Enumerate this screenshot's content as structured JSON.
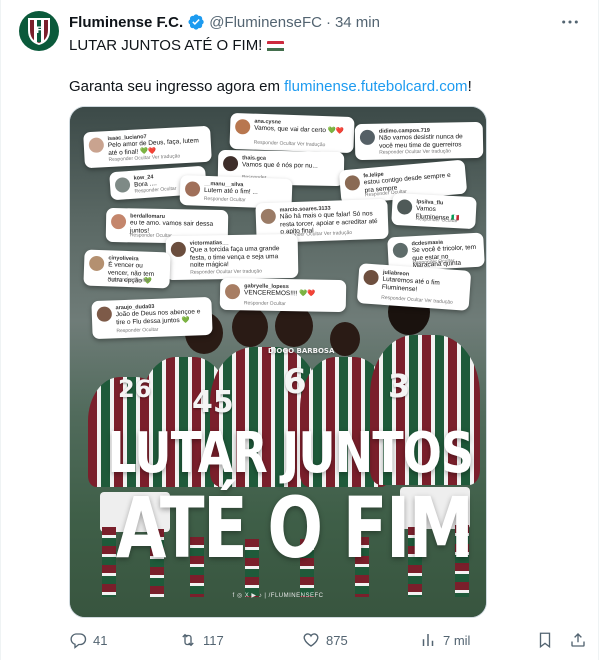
{
  "account": {
    "name": "Fluminense F.C.",
    "handle": "@FluminenseFC",
    "separator": "·",
    "time": "34 min"
  },
  "tweet": {
    "line1": "LUTAR JUNTOS ATÉ O FIM!",
    "line2_prefix": "Garanta seu ingresso agora em ",
    "link": "fluminense.futebolcard.com",
    "line2_suffix": "!"
  },
  "media": {
    "headline_1": "LUTAR JUNTOS",
    "headline_2": "ATÉ O FIM",
    "footer": "f ◎ X ▶ ♪ | /FLUMINENSEFC",
    "shirt_numbers": [
      "6",
      "45",
      "3",
      "26"
    ],
    "shirt_name": "DIOGO BARBOSA",
    "comments": [
      {
        "user": "isaac_luciano7",
        "text": "Pelo amor de Deus, faça, lutem até o final! 💚❤️",
        "actions": "Responder   Ocultar   Ver tradução"
      },
      {
        "user": "ana.cysne",
        "text": "Vamos, que vai dar certo 💚❤️",
        "actions": "Responder   Ocultar   Ver tradução"
      },
      {
        "user": "didimo.campos.719",
        "text": "Não vamos desistir nunca de você meu time de guerreiros",
        "actions": "Responder   Ocultar   Ver tradução"
      },
      {
        "user": "thais.gca",
        "text": "Vamos que é nós por nu...",
        "actions": "Responder"
      },
      {
        "user": "kow_24",
        "text": "Bora ....",
        "actions": "Responder   Ocultar"
      },
      {
        "user": "__manu__silva",
        "text": "Lutem até o fim! ...",
        "actions": "Responder   Ocultar"
      },
      {
        "user": "fe.lelipe",
        "text": "estou contigo desde sempre e pra sempre",
        "actions": "Responder   Ocultar"
      },
      {
        "user": "berdallomaru",
        "text": "eu te amo. vamos sair dessa juntos!",
        "actions": "Responder   Ocultar"
      },
      {
        "user": "marcio.soares.3133",
        "text": "Não há mais o que falar! Só nos resta torcer, apoiar e acreditar até o apito final",
        "actions": "Responder   Ocultar   Ver tradução"
      },
      {
        "user": "lpsilva_flu",
        "text": "Vamos Fluminense 🇮🇹",
        "actions": "Responder   Ocultar"
      },
      {
        "user": "victormatias__",
        "text": "Que a torcida faça uma grande festa, o time vença e seja uma noite mágica!",
        "actions": "Responder   Ocultar   Ver tradução"
      },
      {
        "user": "cinyoliveira",
        "text": "É vencer ou vencer, não tem outra opção 💚",
        "actions": "Responder   Ocultar"
      },
      {
        "user": "dcdesmasia",
        "text": "Se você é tricolor, tem que estar no Maracanã quinta",
        "actions": "Responder   Ocultar"
      },
      {
        "user": "gabryelle_lopess",
        "text": "VENCEREMOS!!!! 💚❤️",
        "actions": "Responder   Ocultar"
      },
      {
        "user": "araujo_duda03",
        "text": "João de Deus nos abençoe e tire o Flu dessa juntos 💚",
        "actions": "Responder   Ocultar"
      },
      {
        "user": "juliabreon",
        "text": "Lutaremos até o fim Fluminense!",
        "actions": "Responder   Ocultar   Ver tradução"
      }
    ]
  },
  "actions": {
    "replies": "41",
    "reposts": "117",
    "likes": "875",
    "views": "7 mil"
  },
  "colors": {
    "brand_green": "#0b5a3b",
    "grena": "#7a1f2b",
    "link": "#1d9bf0",
    "verified": "#1d9bf0",
    "muted": "#536471"
  }
}
